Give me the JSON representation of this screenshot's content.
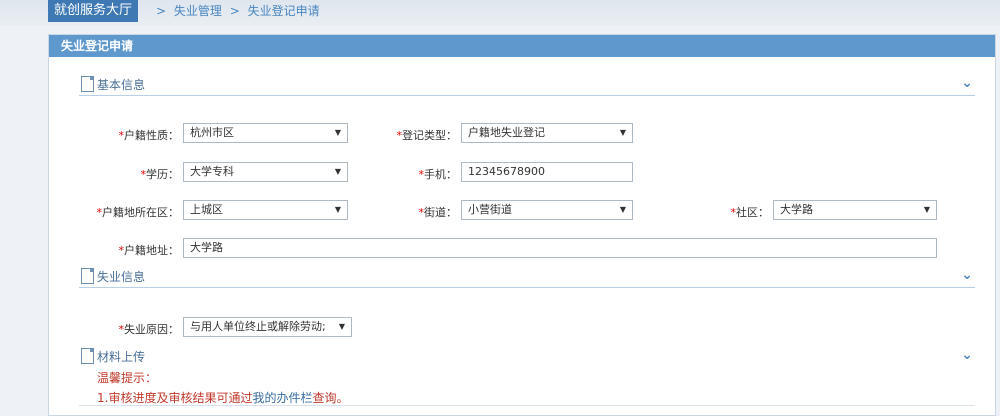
{
  "header": {
    "hall": "就创服务大厅",
    "crumb_sep": ">",
    "crumb1": "失业管理",
    "crumb2": "失业登记申请"
  },
  "panel_title": "失业登记申请",
  "sections": {
    "basic": "基本信息",
    "unemployment": "失业信息",
    "materials": "材料上传"
  },
  "form": {
    "huji_type_label": "户籍性质：",
    "huji_type_value": "杭州市区",
    "reg_type_label": "登记类型：",
    "reg_type_value": "户籍地失业登记",
    "education_label": "学历：",
    "education_value": "大学专科",
    "phone_label": "手机：",
    "phone_value": "12345678900",
    "huji_district_label": "户籍地所在区：",
    "huji_district_value": "上城区",
    "street_label": "街道：",
    "street_value": "小营街道",
    "community_label": "社区：",
    "community_value": "大学路",
    "huji_address_label": "户籍地址：",
    "huji_address_value": "大学路",
    "reason_label": "失业原因：",
    "reason_value": "与用人单位终止或解除劳动;"
  },
  "tips": {
    "title": "温馨提示：",
    "line1_a": "1.审核进度及审核结果可通过",
    "line1_link": "我的办件栏",
    "line1_b": "查询。"
  },
  "colors": {
    "accent": "#5e98cd",
    "hall_bg": "#3e79b3",
    "required": "#dd0000",
    "tip": "#c0392b"
  },
  "icons": {
    "section": "document-icon",
    "collapse": "chevron-down-icon",
    "dropdown": "triangle-down-icon"
  }
}
